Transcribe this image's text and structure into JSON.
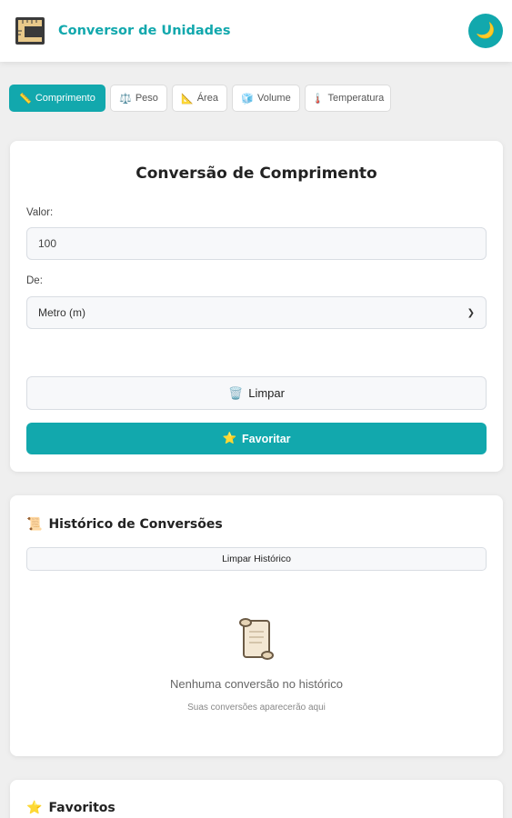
{
  "header": {
    "title": "Conversor de Unidades",
    "logo_icon": "ruler-frame-icon",
    "theme_toggle_icon": "moon-icon",
    "theme_toggle_glyph": "🌙",
    "accent_color": "#12a8ad"
  },
  "tabs": [
    {
      "label": "Comprimento",
      "icon": "📏",
      "active": true
    },
    {
      "label": "Peso",
      "icon": "⚖️",
      "active": false
    },
    {
      "label": "Área",
      "icon": "📐",
      "active": false
    },
    {
      "label": "Volume",
      "icon": "🧊",
      "active": false
    },
    {
      "label": "Temperatura",
      "icon": "🌡️",
      "active": false
    }
  ],
  "converter": {
    "title": "Conversão de Comprimento",
    "value_label": "Valor:",
    "value": "100",
    "from_label": "De:",
    "from_selected": "Metro (m)",
    "clear_icon": "🗑️",
    "clear_label": "Limpar",
    "favorite_icon": "⭐",
    "favorite_label": "Favoritar"
  },
  "history": {
    "icon": "📜",
    "title": "Histórico de Conversões",
    "clear_label": "Limpar Histórico",
    "empty_message": "Nenhuma conversão no histórico",
    "empty_hint": "Suas conversões aparecerão aqui"
  },
  "favorites": {
    "icon": "⭐",
    "title": "Favoritos"
  }
}
